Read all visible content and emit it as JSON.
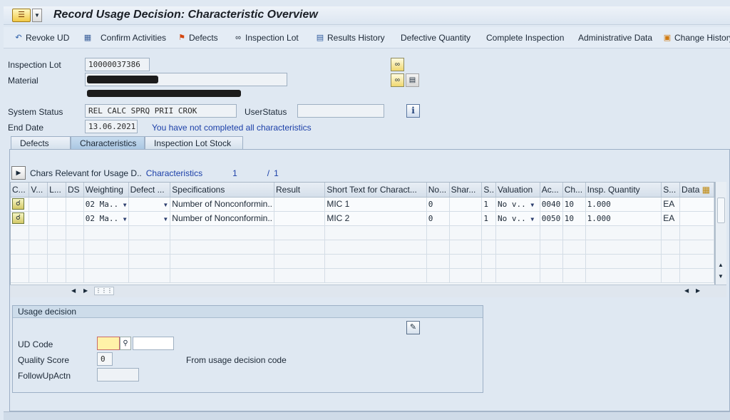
{
  "window": {
    "title": "Record Usage Decision: Characteristic Overview"
  },
  "toolbar": {
    "items": [
      {
        "label": "Revoke UD",
        "icon": "undo-icon"
      },
      {
        "label": "Confirm Activities",
        "icon": "calculator-icon"
      },
      {
        "label": "Defects",
        "icon": "flag-icon"
      },
      {
        "label": "Inspection Lot",
        "icon": "glasses-icon"
      },
      {
        "label": "Results History",
        "icon": "chart-icon"
      },
      {
        "label": "Defective Quantity",
        "icon": ""
      },
      {
        "label": "Complete Inspection",
        "icon": ""
      },
      {
        "label": "Administrative Data",
        "icon": ""
      },
      {
        "label": "Change History",
        "icon": "change-history-icon"
      }
    ]
  },
  "header": {
    "inspection_lot_label": "Inspection Lot",
    "inspection_lot_value": "10000037386",
    "material_label": "Material",
    "system_status_label": "System Status",
    "system_status_value": "REL  CALC SPRQ PRII CROK",
    "user_status_label": "UserStatus",
    "user_status_value": "",
    "end_date_label": "End Date",
    "end_date_value": "13.06.2021",
    "message": "You have not completed all characteristics"
  },
  "tabs": [
    {
      "label": "Defects",
      "active": false
    },
    {
      "label": "Characteristics",
      "active": true
    },
    {
      "label": "Inspection Lot Stock",
      "active": false
    }
  ],
  "chars_section": {
    "relevant_label": "Chars Relevant for Usage D..",
    "characteristics_label": "Characteristics",
    "current": "1",
    "separator": "/",
    "total": "1"
  },
  "grid": {
    "columns": [
      "C...",
      "V...",
      "L...",
      "DS",
      "Weighting",
      "Defect ...",
      "Specifications",
      "Result",
      "Short Text for Charact...",
      "No...",
      "Shar...",
      "S..",
      "Valuation",
      "Ac...",
      "Ch...",
      "Insp. Quantity",
      "S...",
      "Data"
    ],
    "rows": [
      {
        "weighting": "02 Ma..",
        "specifications": "Number of Nonconformin..",
        "short_text": "MIC 1",
        "no": "0",
        "s": "1",
        "valuation": "No v..",
        "ac": "0040",
        "ch": "10",
        "insp_qty": "1.000",
        "unit": "EA"
      },
      {
        "weighting": "02 Ma..",
        "specifications": "Number of Nonconformin..",
        "short_text": "MIC 2",
        "no": "0",
        "s": "1",
        "valuation": "No v..",
        "ac": "0050",
        "ch": "10",
        "insp_qty": "1.000",
        "unit": "EA"
      }
    ]
  },
  "usage_decision": {
    "title": "Usage decision",
    "ud_code_label": "UD Code",
    "ud_code_value": "",
    "quality_score_label": "Quality Score",
    "quality_score_value": "0",
    "from_code_text": "From usage decision code",
    "followup_label": "FollowUpActn",
    "followup_value": ""
  }
}
